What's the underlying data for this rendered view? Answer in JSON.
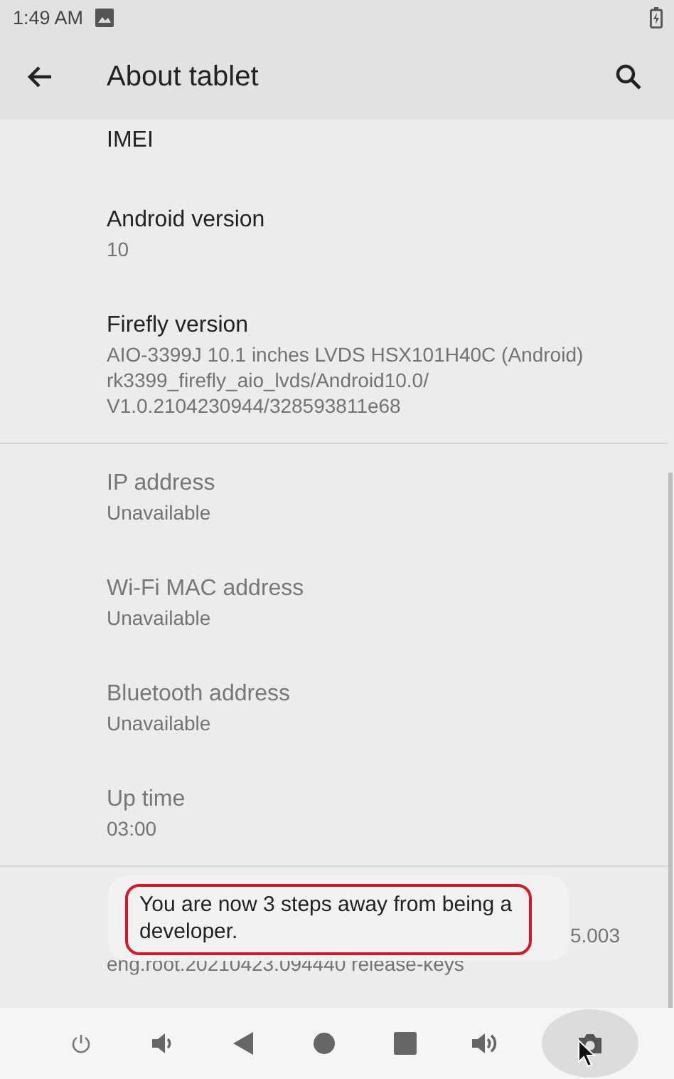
{
  "status_bar": {
    "time": "1:49 AM"
  },
  "app_bar": {
    "title": "About tablet"
  },
  "sections": [
    {
      "items": [
        {
          "title": "IMEI",
          "disabled": false
        },
        {
          "title": "Android version",
          "summary": [
            "10"
          ],
          "disabled": false
        },
        {
          "title": "Firefly version",
          "summary": [
            "AIO-3399J 10.1 inches LVDS HSX101H40C (Android)",
            "rk3399_firefly_aio_lvds/Android10.0/",
            "V1.0.2104230944/328593811e68"
          ],
          "disabled": false
        }
      ]
    },
    {
      "items": [
        {
          "title": "IP address",
          "summary": [
            "Unavailable"
          ],
          "disabled": true
        },
        {
          "title": "Wi-Fi MAC address",
          "summary": [
            "Unavailable"
          ],
          "disabled": true
        },
        {
          "title": "Bluetooth address",
          "summary": [
            "Unavailable"
          ],
          "disabled": true
        },
        {
          "title": "Up time",
          "summary": [
            "03:00"
          ],
          "disabled": true
        }
      ]
    },
    {
      "items": [
        {
          "summary": [
            "5.003",
            "eng.root.20210423.094440 release-keys"
          ]
        }
      ]
    }
  ],
  "toast": {
    "text": "You are now 3 steps away from being a developer.",
    "highlighted": true
  },
  "nav_bar": [
    {
      "kind": "power",
      "selected": false
    },
    {
      "kind": "volume-down",
      "selected": false
    },
    {
      "kind": "back",
      "selected": false
    },
    {
      "kind": "home",
      "selected": false
    },
    {
      "kind": "recents",
      "selected": false
    },
    {
      "kind": "volume-up",
      "selected": false
    },
    {
      "kind": "screenshot",
      "selected": true
    }
  ]
}
